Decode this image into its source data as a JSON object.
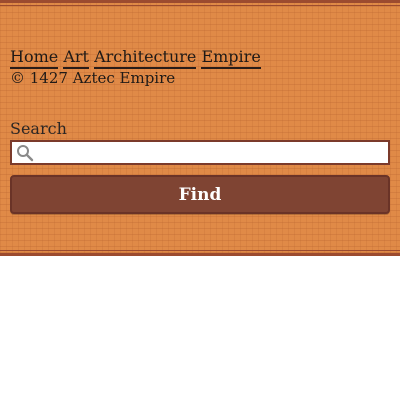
{
  "nav": {
    "links": [
      {
        "label": "Home"
      },
      {
        "label": "Art"
      },
      {
        "label": "Architecture"
      },
      {
        "label": "Empire"
      }
    ]
  },
  "footer": {
    "copyright": "© 1427 Aztec Empire"
  },
  "search": {
    "label": "Search",
    "value": "",
    "button_label": "Find",
    "icon": "search-icon"
  },
  "colors": {
    "panel_bg": "#e08a47",
    "border": "#9c4b2f",
    "button_bg": "#7f4433",
    "input_border": "#7b3a2b"
  }
}
